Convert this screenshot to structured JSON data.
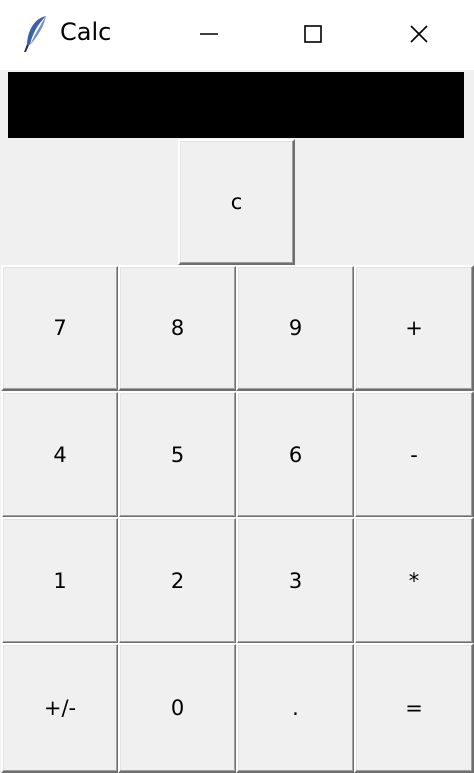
{
  "window": {
    "title": "Calc",
    "icon": "feather-icon",
    "controls": {
      "minimize_icon": "minimize-icon",
      "maximize_icon": "maximize-icon",
      "close_icon": "close-icon"
    }
  },
  "display": {
    "value": ""
  },
  "buttons": {
    "clear": "c",
    "rows": [
      [
        "7",
        "8",
        "9",
        "+"
      ],
      [
        "4",
        "5",
        "6",
        "-"
      ],
      [
        "1",
        "2",
        "3",
        "*"
      ],
      [
        "+/-",
        "0",
        ".",
        "="
      ]
    ]
  },
  "colors": {
    "display_background": "#000000",
    "button_face": "#f0f0f0",
    "titlebar": "#ffffff"
  }
}
